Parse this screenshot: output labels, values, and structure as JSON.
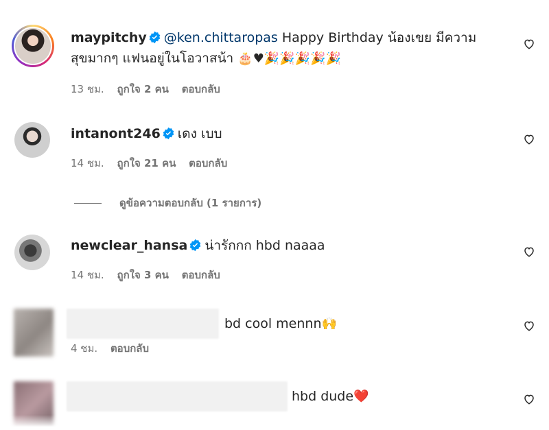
{
  "comments": [
    {
      "username": "maypitchy",
      "mention": "@ken.chittaropas",
      "text_line1": "Happy Birthday น้องเขย มีความ",
      "text_line2": "สุขมากๆ แฟนอยู่ในโอวาสน้า",
      "emojis": "🎂♥🎉🎉🎉🎉🎉",
      "time": "13 ชม.",
      "likes": "ถูกใจ 2 คน",
      "reply": "ตอบกลับ"
    },
    {
      "username": "intanont246",
      "text": "เดง เบบ",
      "time": "14 ชม.",
      "likes": "ถูกใจ 21 คน",
      "reply": "ตอบกลับ",
      "view_replies": "ดูข้อความตอบกลับ (1 รายการ)"
    },
    {
      "username": "newclear_hansa",
      "text": "น่ารักกก hbd naaaa",
      "time": "14 ชม.",
      "likes": "ถูกใจ 3 คน",
      "reply": "ตอบกลับ"
    },
    {
      "text": "bd cool mennn",
      "emoji": "🙌",
      "time": "4 ชม.",
      "reply": "ตอบกลับ"
    },
    {
      "text": "hbd dude",
      "emoji": "❤️"
    }
  ],
  "icons": {
    "verified": "verified-badge-icon",
    "like": "heart-outline-icon"
  },
  "colors": {
    "verified": "#0095f6",
    "mention": "#00376b",
    "secondary_text": "#737373"
  }
}
